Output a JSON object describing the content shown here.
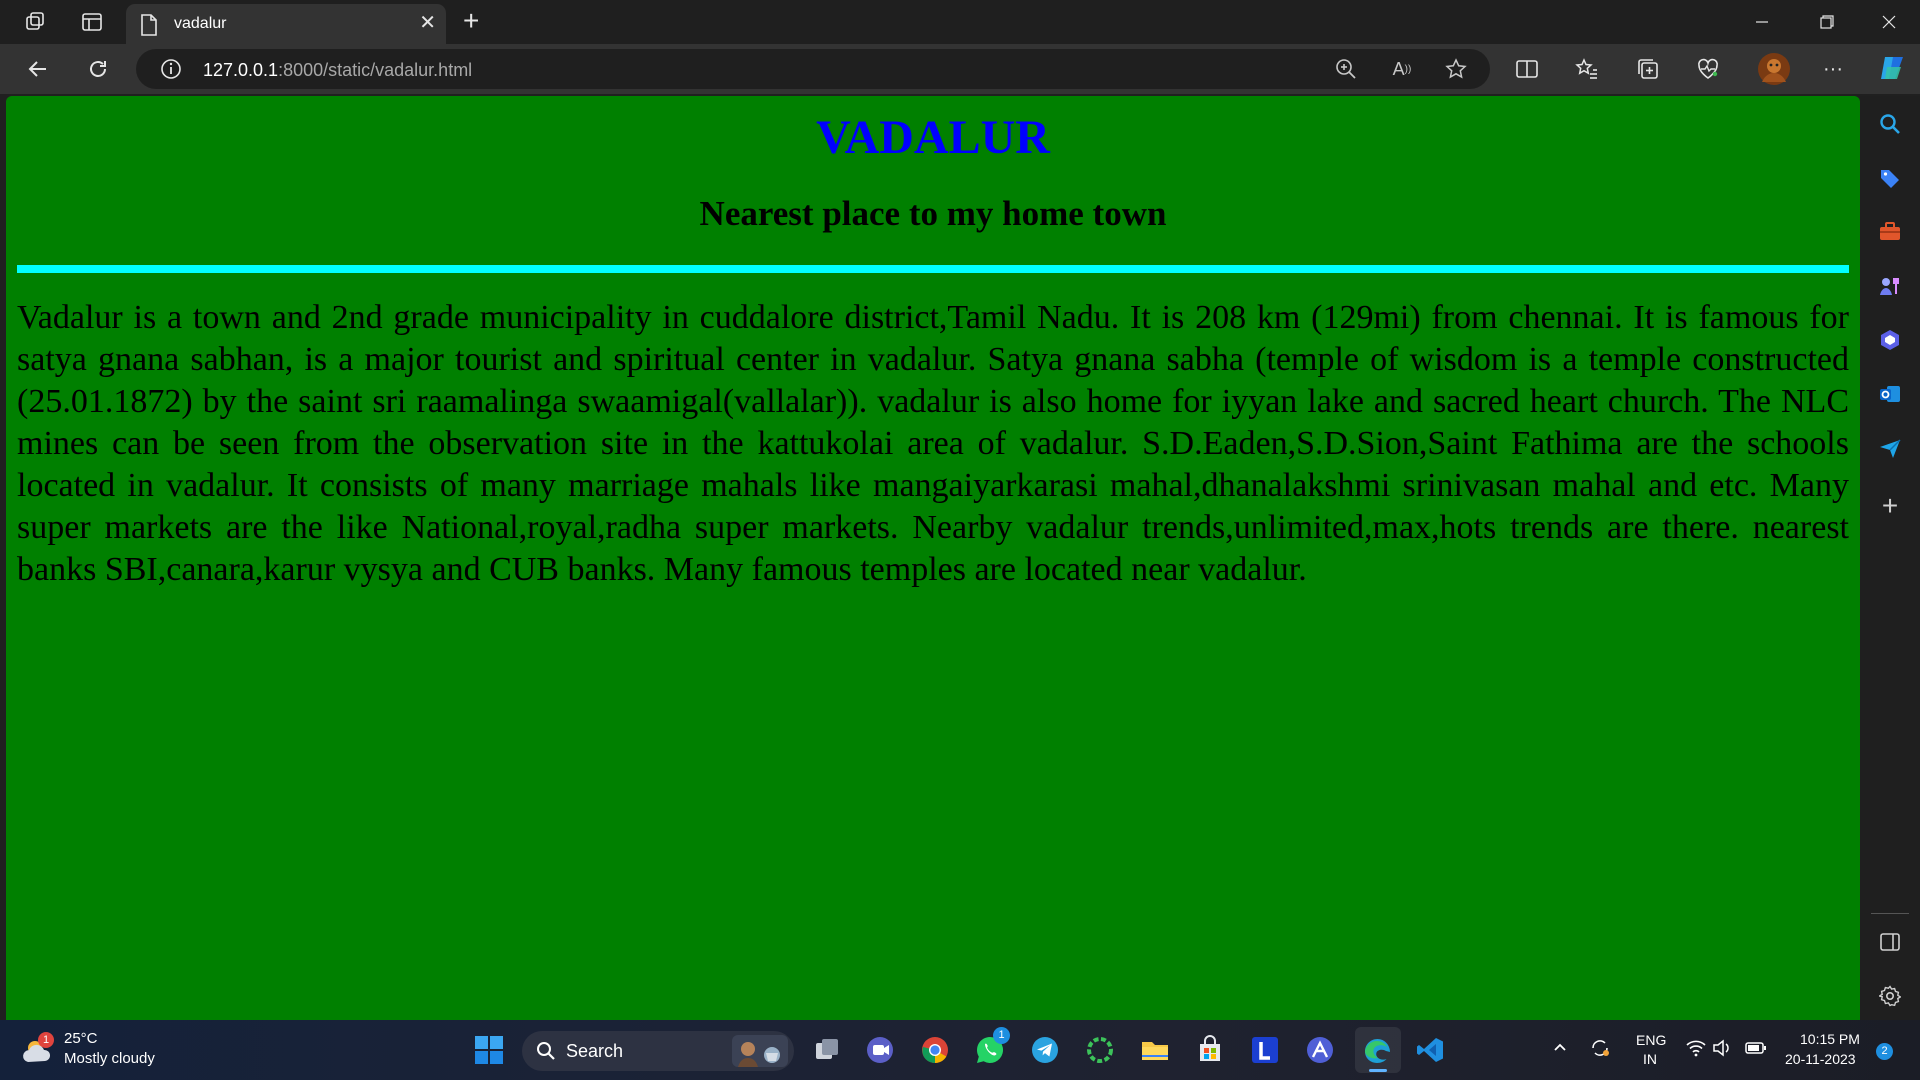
{
  "browser": {
    "tab_title": "vadalur",
    "url_host": "127.0.0.1",
    "url_path": ":8000/static/vadalur.html"
  },
  "page": {
    "heading": "VADALUR",
    "subheading": "Nearest place to my home town",
    "body_text": "Vadalur is a town and 2nd grade municipality in cuddalore district,Tamil Nadu. It is 208 km (129mi) from chennai. It is famous for satya gnana sabhan, is a major tourist and spiritual center in vadalur. Satya gnana sabha (temple of wisdom is a temple constructed (25.01.1872) by the saint sri raamalinga swaamigal(vallalar)). vadalur is also home for iyyan lake and sacred heart church. The NLC mines can be seen from the observation site in the kattukolai area of vadalur. S.D.Eaden,S.D.Sion,Saint Fathima are the schools located in vadalur. It consists of many marriage mahals like mangaiyarkarasi mahal,dhanalakshmi srinivasan mahal and etc. Many super markets are the like National,royal,radha super markets. Nearby vadalur trends,unlimited,max,hots trends are there. nearest banks SBI,canara,karur vysya and CUB banks. Many famous temples are located near vadalur.",
    "background_color": "#008000",
    "heading_color": "#0000ff",
    "rule_color": "#00ffff"
  },
  "taskbar": {
    "weather_temp": "25°C",
    "weather_desc": "Mostly cloudy",
    "weather_badge": "1",
    "search_label": "Search",
    "whatsapp_badge": "1",
    "language": "ENG",
    "region": "IN",
    "time": "10:15 PM",
    "date": "20-11-2023",
    "notification_count": "2"
  }
}
